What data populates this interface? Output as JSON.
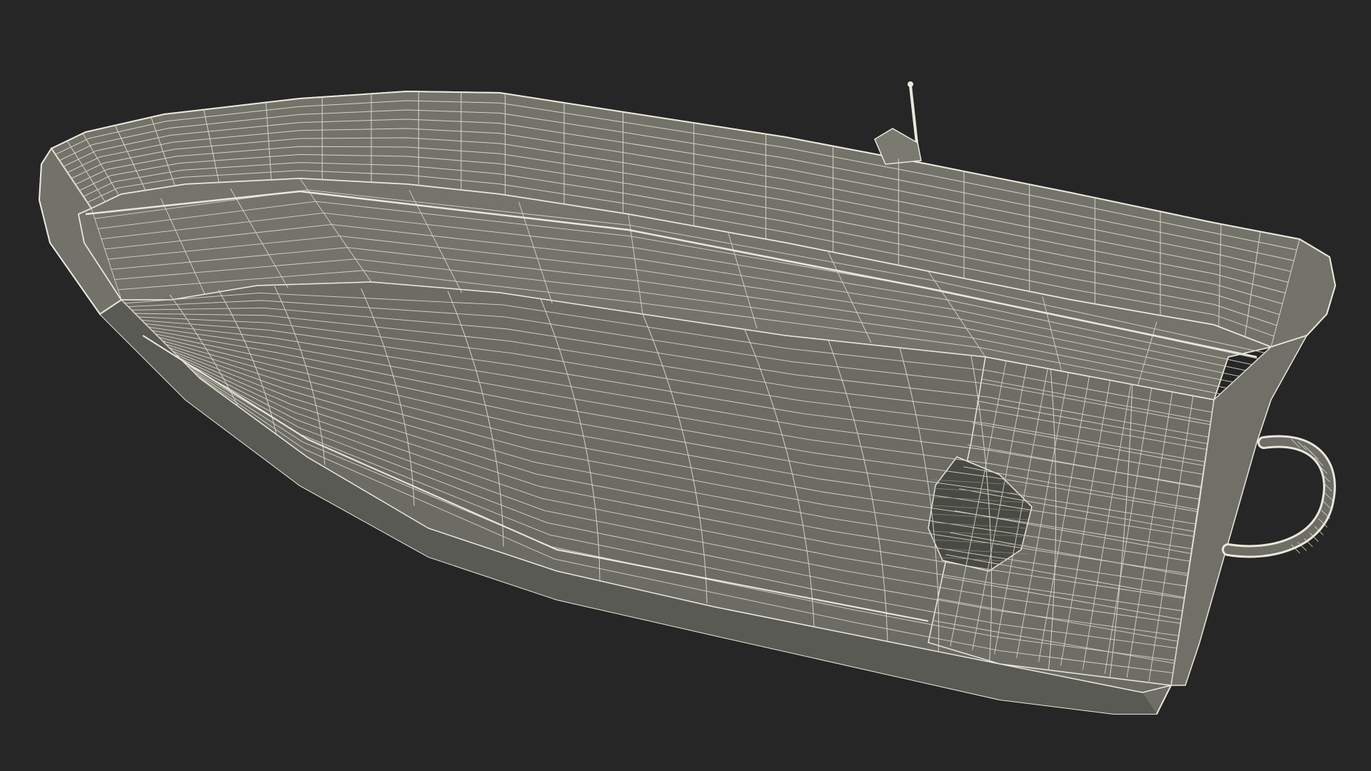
{
  "scene": {
    "subject": "boat-hull-wireframe",
    "render_style": "wireframe"
  },
  "colors": {
    "background": "#262626",
    "hull_fill": "#6e6e66",
    "hull_shadow": "#5a5a54",
    "cockpit_fill": "#74746b",
    "wire": "#e8e8dc",
    "wire_faint": "#d4d4c6",
    "opening_fill": "#4a4a45"
  }
}
